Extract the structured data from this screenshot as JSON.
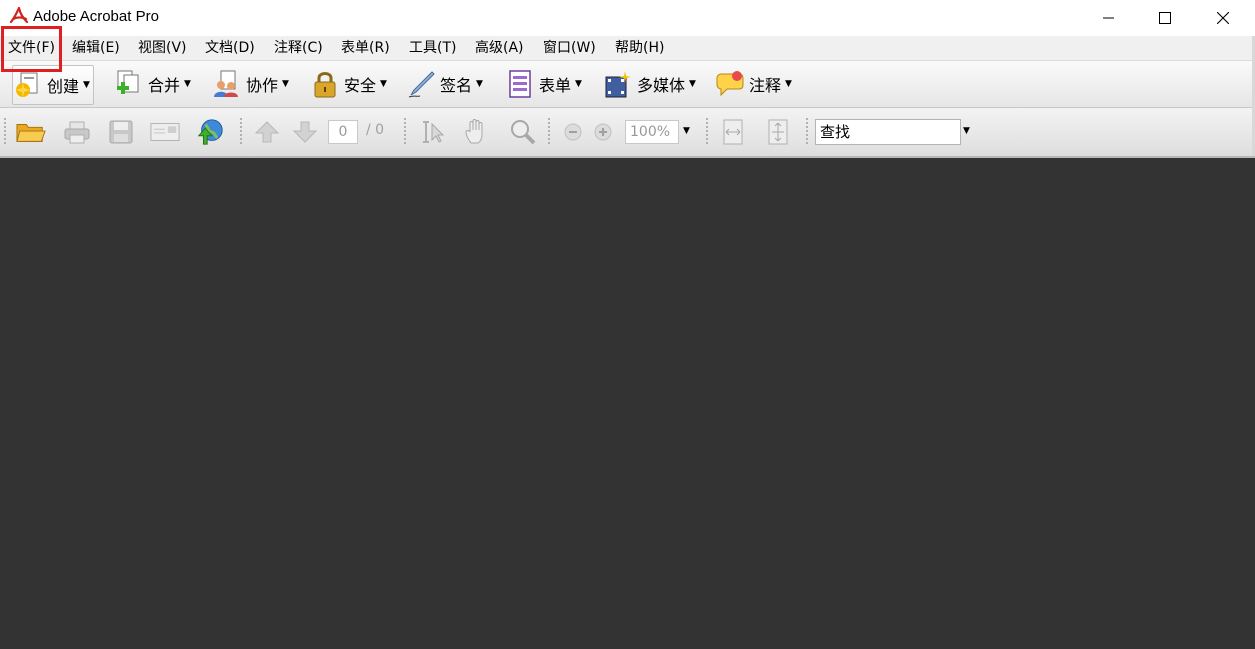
{
  "window": {
    "title": "Adobe Acrobat Pro"
  },
  "menu": {
    "items": [
      {
        "label": "文件(F)"
      },
      {
        "label": "编辑(E)"
      },
      {
        "label": "视图(V)"
      },
      {
        "label": "文档(D)"
      },
      {
        "label": "注释(C)"
      },
      {
        "label": "表单(R)"
      },
      {
        "label": "工具(T)"
      },
      {
        "label": "高级(A)"
      },
      {
        "label": "窗口(W)"
      },
      {
        "label": "帮助(H)"
      }
    ]
  },
  "tasks": {
    "items": [
      {
        "label": "创建",
        "icon": "create-pdf-icon"
      },
      {
        "label": "合并",
        "icon": "combine-files-icon"
      },
      {
        "label": "协作",
        "icon": "collaborate-icon"
      },
      {
        "label": "安全",
        "icon": "lock-icon"
      },
      {
        "label": "签名",
        "icon": "pen-icon"
      },
      {
        "label": "表单",
        "icon": "form-icon"
      },
      {
        "label": "多媒体",
        "icon": "multimedia-icon"
      },
      {
        "label": "注释",
        "icon": "comment-icon"
      }
    ]
  },
  "toolbar": {
    "page_current": "0",
    "page_total": "/ 0",
    "zoom": "100%",
    "search_placeholder": "查找"
  },
  "colors": {
    "doc_background": "#333333",
    "highlight": "#e02020"
  }
}
